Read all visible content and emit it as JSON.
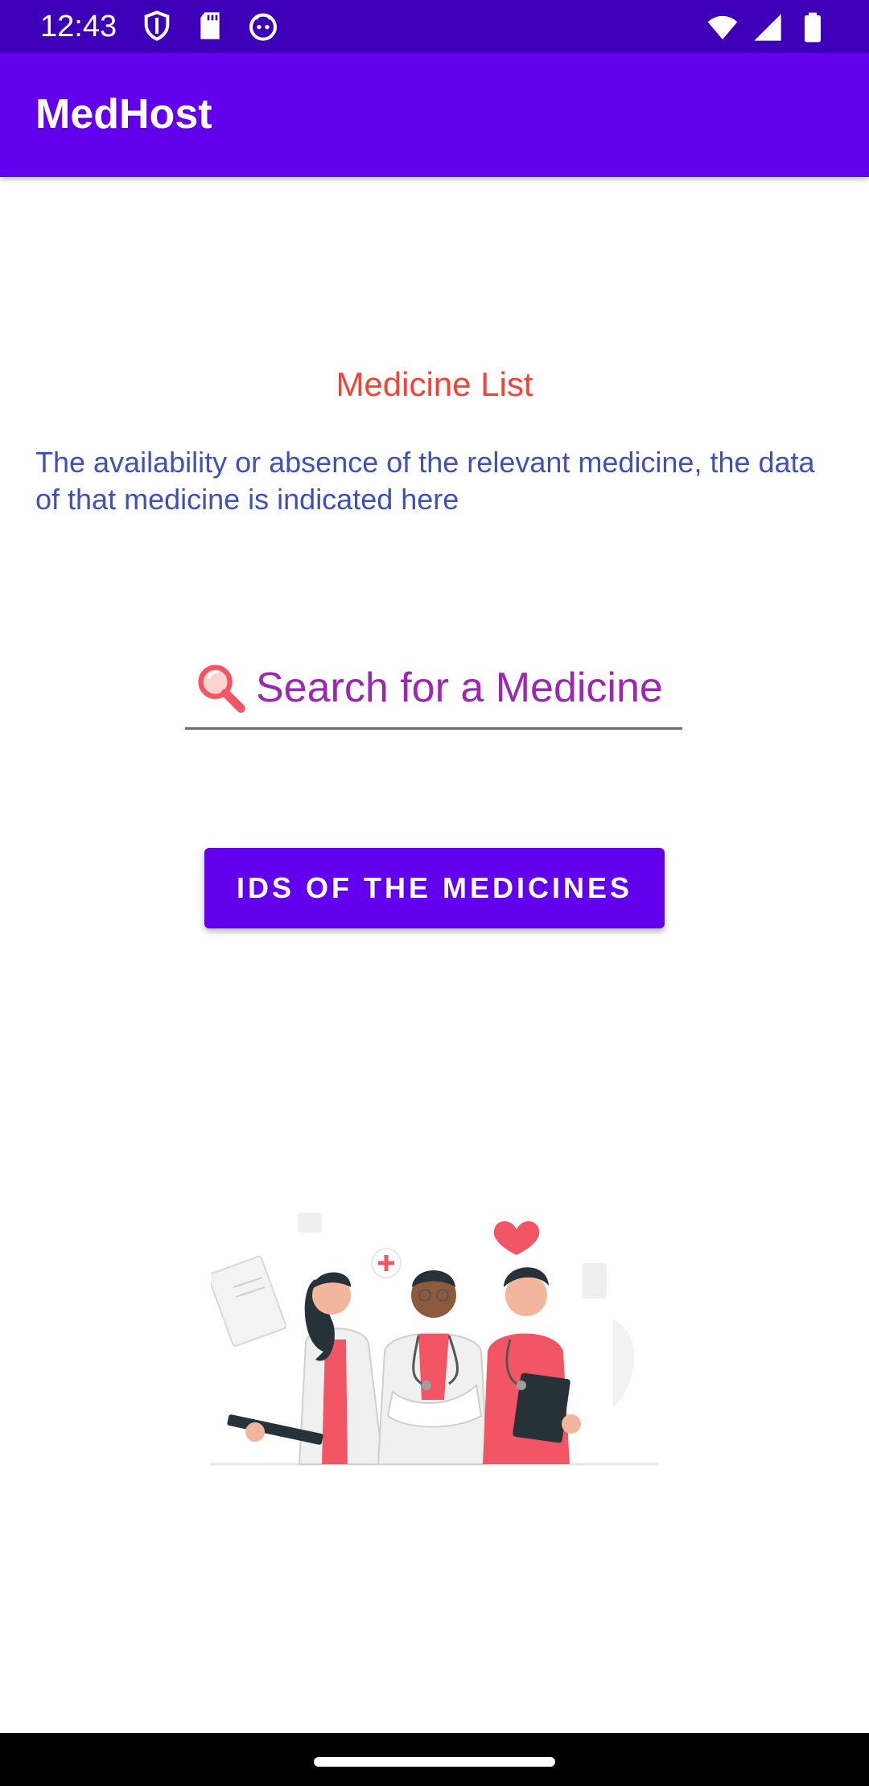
{
  "status_bar": {
    "time": "12:43",
    "icons_left": [
      "shield-icon",
      "sd-card-icon",
      "android-face-icon"
    ],
    "icons_right": [
      "wifi-icon",
      "signal-icon",
      "battery-icon"
    ]
  },
  "app_bar": {
    "title": "MedHost"
  },
  "main": {
    "heading": "Medicine List",
    "description": "The availability or absence of the relevant medicine, the data of that medicine is indicated here",
    "search": {
      "placeholder": "Search for a Medicine",
      "value": ""
    },
    "ids_button_label": "IDS OF THE MEDICINES",
    "illustration": "medical-staff-illustration"
  },
  "colors": {
    "status_bar": "#3d00b8",
    "app_bar": "#6200ee",
    "heading": "#f44336",
    "description": "#3f51b5",
    "search_text": "#9c27b0",
    "button": "#6200ee",
    "accent_red": "#f25563"
  }
}
